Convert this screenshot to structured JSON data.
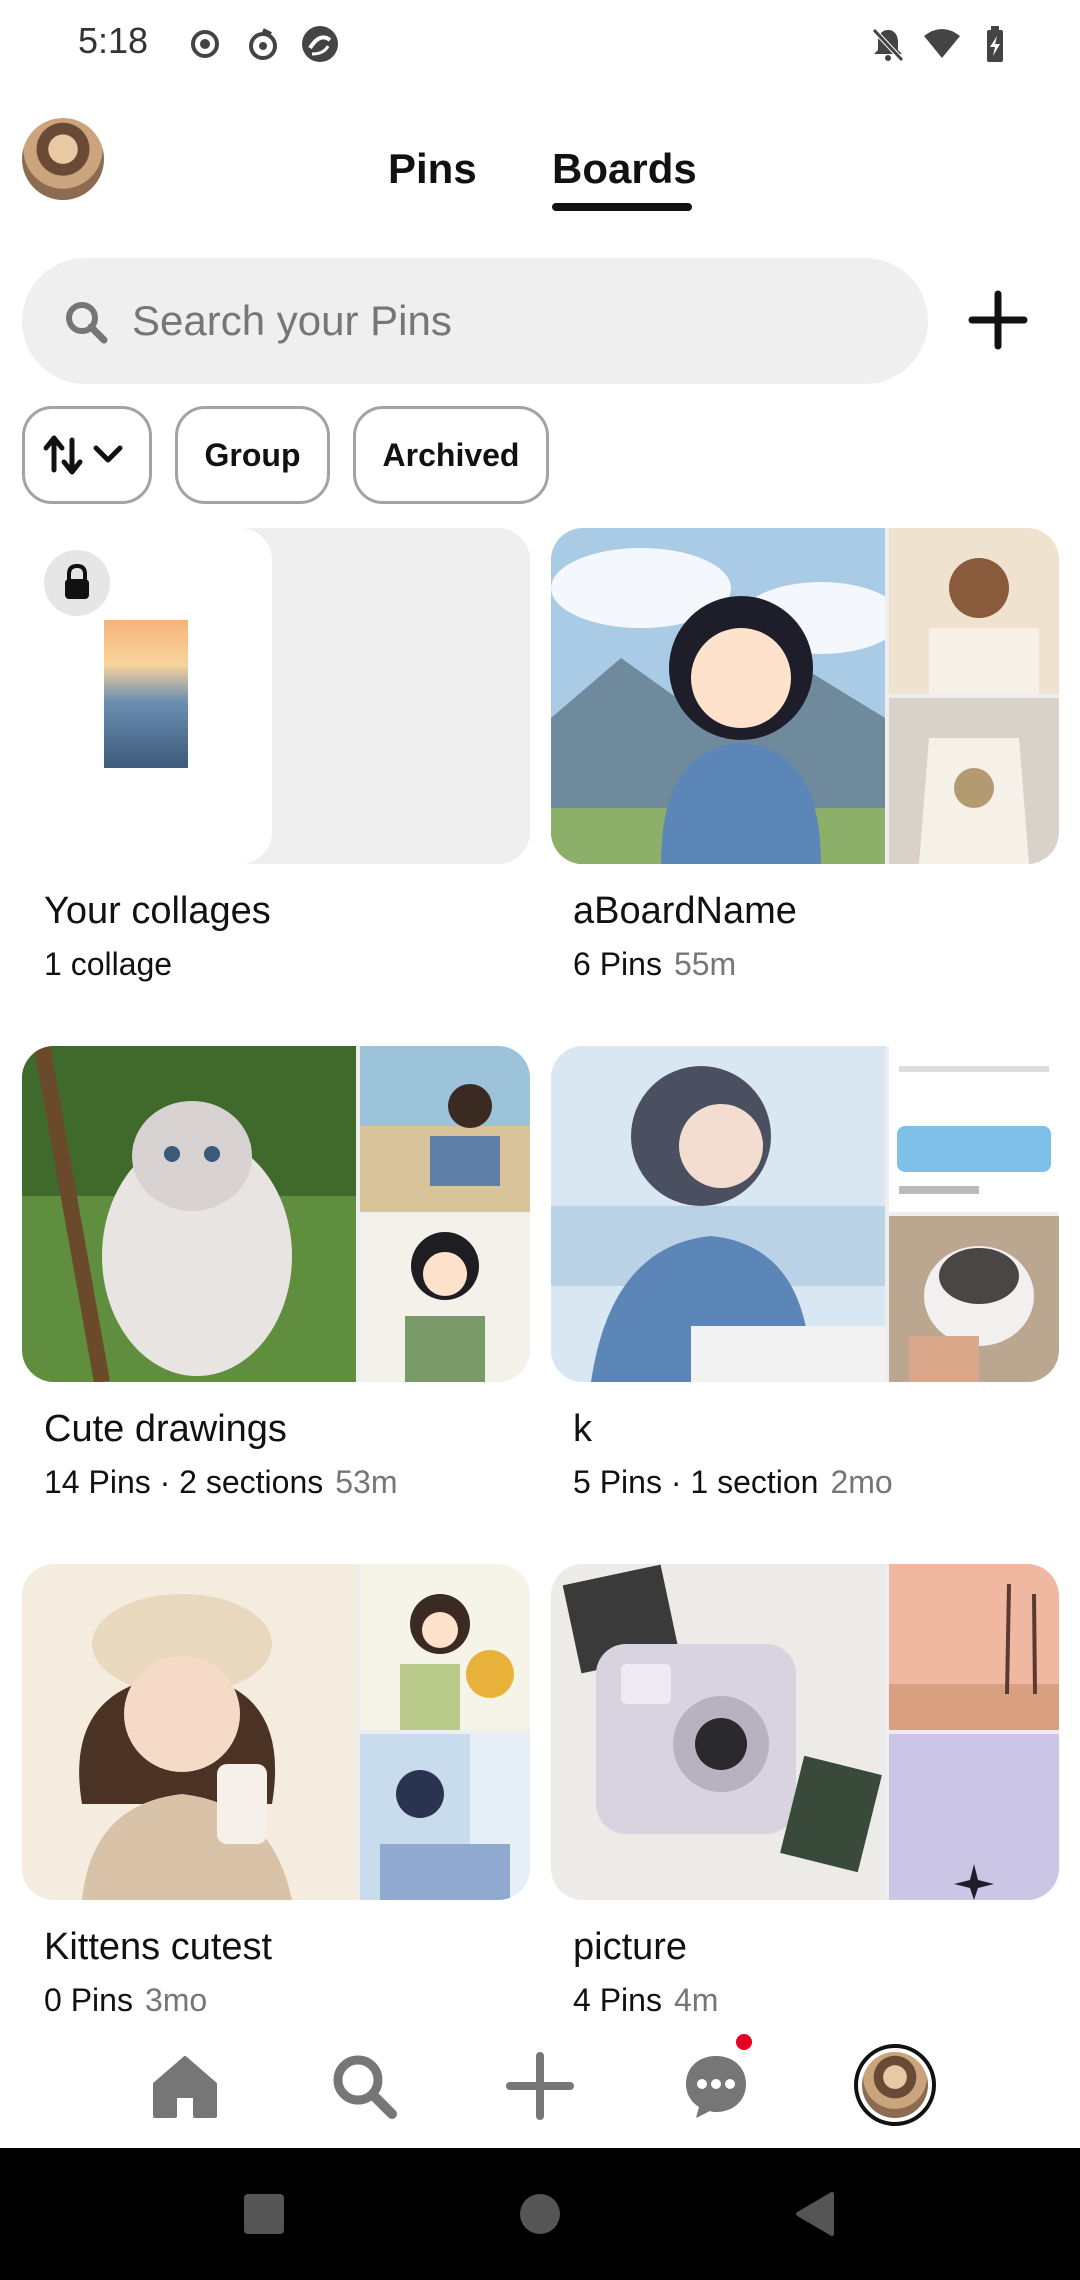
{
  "status_bar": {
    "time": "5:18",
    "left_icons": [
      "record-icon",
      "sync-icon",
      "browser-icon"
    ],
    "right_icons": [
      "notifications-off-icon",
      "wifi-icon",
      "battery-charging-icon"
    ]
  },
  "header": {
    "tabs": [
      {
        "label": "Pins",
        "active": false
      },
      {
        "label": "Boards",
        "active": true
      }
    ]
  },
  "search": {
    "placeholder": "Search your Pins",
    "value": ""
  },
  "filters": {
    "sort_icon": "sort-arrows-icon",
    "chips": [
      "Group",
      "Archived"
    ]
  },
  "boards": [
    {
      "title": "Your collages",
      "meta": "1 collage",
      "time": "",
      "locked": true
    },
    {
      "title": "aBoardName",
      "meta": "6 Pins",
      "time": "55m"
    },
    {
      "title": "Cute drawings",
      "meta": "14 Pins · 2 sections",
      "time": "53m"
    },
    {
      "title": "k",
      "meta": "5 Pins · 1 section",
      "time": "2mo"
    },
    {
      "title": "Kittens cutest",
      "meta": "0 Pins",
      "time": "3mo"
    },
    {
      "title": "picture",
      "meta": "4 Pins",
      "time": "4m"
    }
  ],
  "bottom_nav": {
    "items": [
      "home-icon",
      "search-icon",
      "create-icon",
      "messages-icon",
      "profile-avatar"
    ],
    "messages_badge": true
  },
  "colors": {
    "accent": "#e60023",
    "search_bg": "#efefef",
    "muted_text": "#767676",
    "chip_border": "#a3a3a3"
  }
}
